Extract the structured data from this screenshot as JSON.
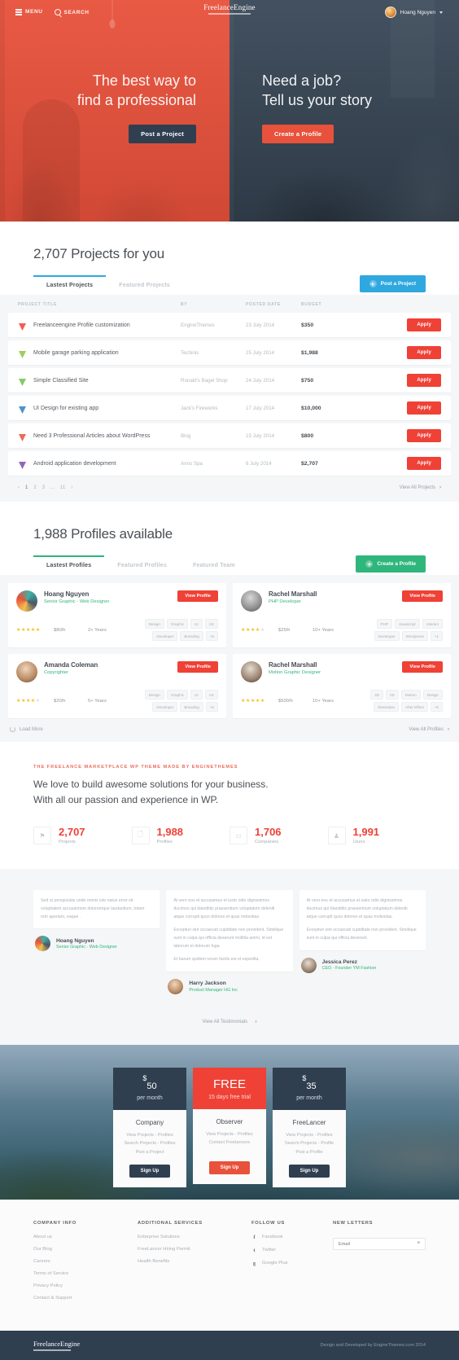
{
  "topnav": {
    "menu_label": "MENU",
    "search_label": "SEARCH",
    "brand": "FreelanceEngine",
    "user_name": "Hoang Nguyen"
  },
  "hero": {
    "left": {
      "line1": "The best way to",
      "line2": "find a professional",
      "button": "Post a Project"
    },
    "right": {
      "line1": "Need a job?",
      "line2": "Tell us your story",
      "button": "Create a Profile"
    }
  },
  "projects": {
    "title": "2,707 Projects for you",
    "tabs": [
      {
        "label": "Lastest Projects",
        "active": true
      },
      {
        "label": "Featured Projects",
        "active": false
      }
    ],
    "action_label": "Post a Project",
    "columns": [
      "PROJECT TITLE",
      "BY",
      "POSTED DATE",
      "BUDGET"
    ],
    "rows": [
      {
        "title": "Freelanceengine Profile customization",
        "by": "EngineThemes",
        "date": "23 July 2014",
        "budget": "$350",
        "apply": "Apply",
        "icon_color": "#ef4136"
      },
      {
        "title": "Mobile garage parking application",
        "by": "Techinis",
        "date": "25 July 2014",
        "budget": "$1,988",
        "apply": "Apply",
        "icon_color": "#8dc63f"
      },
      {
        "title": "Simple Classified Site",
        "by": "Ronald's Bagel Shop",
        "date": "24 July 2014",
        "budget": "$750",
        "apply": "Apply",
        "icon_color": "#6cc24a"
      },
      {
        "title": "UI Design for existing app",
        "by": "Jack's Fireworks",
        "date": "17 July 2014",
        "budget": "$10,000",
        "apply": "Apply",
        "icon_color": "#2f80c4"
      },
      {
        "title": "Need 3 Professional Articles about WordPress",
        "by": "Blog",
        "date": "15 July 2014",
        "budget": "$800",
        "apply": "Apply",
        "icon_color": "#e8513b"
      },
      {
        "title": "Android application development",
        "by": "Anns Spa",
        "date": "6 July 2014",
        "budget": "$2,707",
        "apply": "Apply",
        "icon_color": "#7b4fa8"
      }
    ],
    "pager": [
      "1",
      "2",
      "3",
      "...",
      "11"
    ],
    "pager_current": "1",
    "view_all": "View All Projects"
  },
  "profiles": {
    "title": "1,988 Profiles available",
    "tabs": [
      {
        "label": "Lastest Profiles",
        "active": true
      },
      {
        "label": "Featured Profiles",
        "active": false
      },
      {
        "label": "Featured Team",
        "active": false
      }
    ],
    "action_label": "Create a Profile",
    "cards": [
      {
        "name": "Hoang Nguyen",
        "role": "Senior Graphic - Web Designer",
        "button": "View Profile",
        "stars": 5,
        "rate": "$80/h",
        "experience": "2+ Years",
        "tags": [
          "Design",
          "Graphic",
          "UI",
          "UX",
          "Developer",
          "Branding",
          "+5"
        ]
      },
      {
        "name": "Rachel Marshall",
        "role": "PHP Developer",
        "button": "View Profile",
        "stars": 4,
        "rate": "$25/h",
        "experience": "10+ Years",
        "tags": [
          "PHP",
          "Javascript",
          "Interact",
          "Developer",
          "Wordpress",
          "+1"
        ]
      },
      {
        "name": "Amanda Coleman",
        "role": "Copyrighter",
        "button": "View Profile",
        "stars": 4,
        "rate": "$20/h",
        "experience": "5+ Years",
        "tags": [
          "Design",
          "Graphic",
          "UI",
          "UX",
          "Developer",
          "Branding",
          "+5"
        ]
      },
      {
        "name": "Rachel Marshall",
        "role": "Motion Graphic Designer",
        "button": "View Profile",
        "stars": 5,
        "rate": "$500/h",
        "experience": "10+ Years",
        "tags": [
          "3D",
          "2D",
          "Motion",
          "Design",
          "Illustration",
          "After Effect",
          "+6"
        ]
      }
    ],
    "load_more": "Load More",
    "view_all": "View All Profiles"
  },
  "about": {
    "eyebrow": "THE FREELANCE MARKETPLACE WP THEME MADE BY ENGINETHEMES",
    "headline_line1": "We love to build awesome solutions for your business.",
    "headline_line2": "With all our passion and experience in WP.",
    "stats": [
      {
        "icon": "flag-icon",
        "glyph": "⚑",
        "number": "2,707",
        "label": "Projects"
      },
      {
        "icon": "file-icon",
        "glyph": "🗋",
        "number": "1,988",
        "label": "Profiles"
      },
      {
        "icon": "briefcase-icon",
        "glyph": "▭",
        "number": "1,706",
        "label": "Companies"
      },
      {
        "icon": "user-icon",
        "glyph": "♟",
        "number": "1,991",
        "label": "Users"
      }
    ]
  },
  "testimonials": {
    "items": [
      {
        "paragraphs": [
          "Sed ut perspiciatis unde omnis iste natus error sit voluptatem accusantium doloremque laudantium, totam rem aperiam, eaque ."
        ],
        "name": "Hoang Nguyen",
        "role": "Senior Graphic - Web Designer"
      },
      {
        "paragraphs": [
          "At vero eos et accusamus et iusto odio dignissimos ducimus qui blanditiis praesentium voluptatum deleniti atque corrupti quos dolores et quas molestias.",
          "Excepturi sint occaecati cupiditate non provident. Similique sunt in culpa qui officia deserunt mollitia animi, id est laborum et dolorum fuga.",
          "Et harum quidem rerum facilis est et expedita."
        ],
        "name": "Harry Jackson",
        "role": "Product Manager HG Inc"
      },
      {
        "paragraphs": [
          "At vero eos et accusamus et iusto odio dignissimos ducimus qui blanditiis praesentium voluptatum deleniti atque corrupti quos dolores et quas molestias.",
          "Excepturi sint occaecati cupiditate non provident. Similique sunt in culpa qui officia deserunt."
        ],
        "name": "Jessica Perez",
        "role": "CEO - Founder YM Fashion"
      }
    ],
    "view_all": "View All Testimonials"
  },
  "pricing": {
    "plans": [
      {
        "price_symbol": "$",
        "price": "50",
        "per": "per month",
        "name": "Company",
        "features": [
          "View Projects - Profiles",
          "Search Projects - Profiles",
          "Post a Project"
        ],
        "button": "Sign Up",
        "style": "dark"
      },
      {
        "price_symbol": "",
        "price": "FREE",
        "per": "15 days free trial",
        "name": "Observer",
        "features": [
          "View Projects - Profiles",
          "Contact Freelancers"
        ],
        "button": "Sign Up",
        "style": "red"
      },
      {
        "price_symbol": "$",
        "price": "35",
        "per": "per month",
        "name": "FreeLancer",
        "features": [
          "View Projects - Profiles",
          "Search Projects - Profile",
          "Post a Profile"
        ],
        "button": "Sign Up",
        "style": "dark"
      }
    ]
  },
  "footer": {
    "columns": [
      {
        "heading": "COMPANY INFO",
        "links": [
          "About us",
          "Our Blog",
          "Careers",
          "Terms of Service",
          "Privacy Policy",
          "Contact & Support"
        ]
      },
      {
        "heading": "ADDITIONAL SERVICES",
        "links": [
          "Enterprise Solutions",
          "FreeLancer Hiring Permit",
          "Health Benefits"
        ]
      }
    ],
    "social_heading": "FOLLOW US",
    "social": [
      {
        "glyph": "f",
        "label": "Facebook"
      },
      {
        "glyph": "t",
        "label": "Twitter"
      },
      {
        "glyph": "g",
        "label": "Google Plus"
      }
    ],
    "newsletter_heading": "NEW LETTERS",
    "newsletter_placeholder": "Email",
    "brand": "FreelanceEngine",
    "credit": "Design and Developed by EngineThemes.com 2014"
  }
}
